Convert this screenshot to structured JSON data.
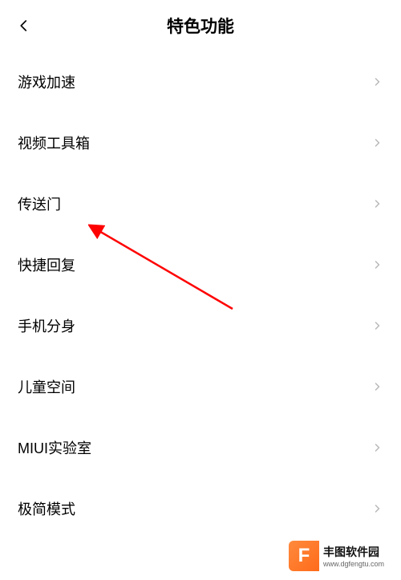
{
  "header": {
    "title": "特色功能"
  },
  "items": [
    {
      "label": "游戏加速"
    },
    {
      "label": "视频工具箱"
    },
    {
      "label": "传送门"
    },
    {
      "label": "快捷回复"
    },
    {
      "label": "手机分身"
    },
    {
      "label": "儿童空间"
    },
    {
      "label": "MIUI实验室"
    },
    {
      "label": "极简模式"
    }
  ],
  "watermark": {
    "logo_letter": "F",
    "name": "丰图软件园",
    "url": "www.dgfengtu.com"
  }
}
